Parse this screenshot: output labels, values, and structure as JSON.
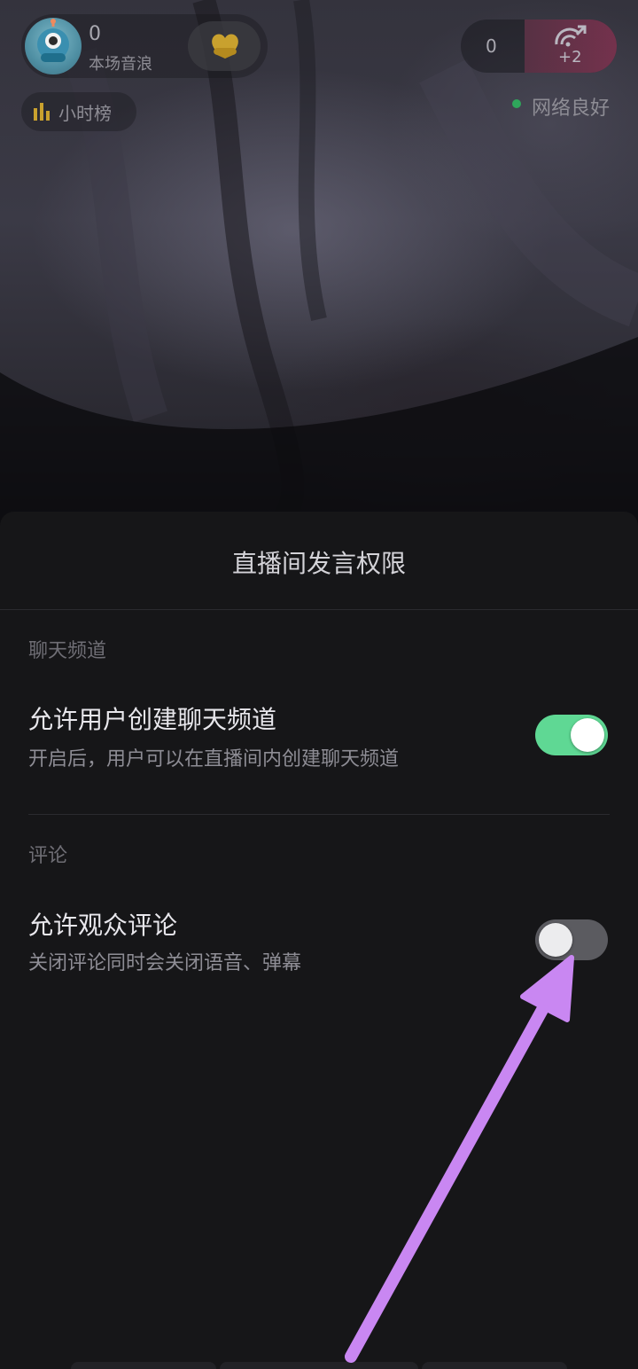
{
  "top_bar": {
    "anchor_count": "0",
    "anchor_label": "本场音浪",
    "rank_label": "小时榜",
    "viewer_count": "0",
    "fans_increment": "+2",
    "network_status": "网络良好"
  },
  "sheet": {
    "title": "直播间发言权限",
    "sections": [
      {
        "label": "聊天频道",
        "setting_title": "允许用户创建聊天频道",
        "setting_desc": "开启后，用户可以在直播间内创建聊天频道",
        "enabled": true
      },
      {
        "label": "评论",
        "setting_title": "允许观众评论",
        "setting_desc": "关闭评论同时会关闭语音、弹幕",
        "enabled": false
      }
    ]
  },
  "colors": {
    "toggle_on": "#5fd894",
    "toggle_off": "#5b5b60",
    "network_dot": "#2fa65b",
    "annotation_arrow": "#c987f2"
  },
  "icons": [
    "avatar",
    "heart-gift-icon",
    "bar-chart-icon",
    "fans-signal-icon",
    "network-status-dot"
  ]
}
